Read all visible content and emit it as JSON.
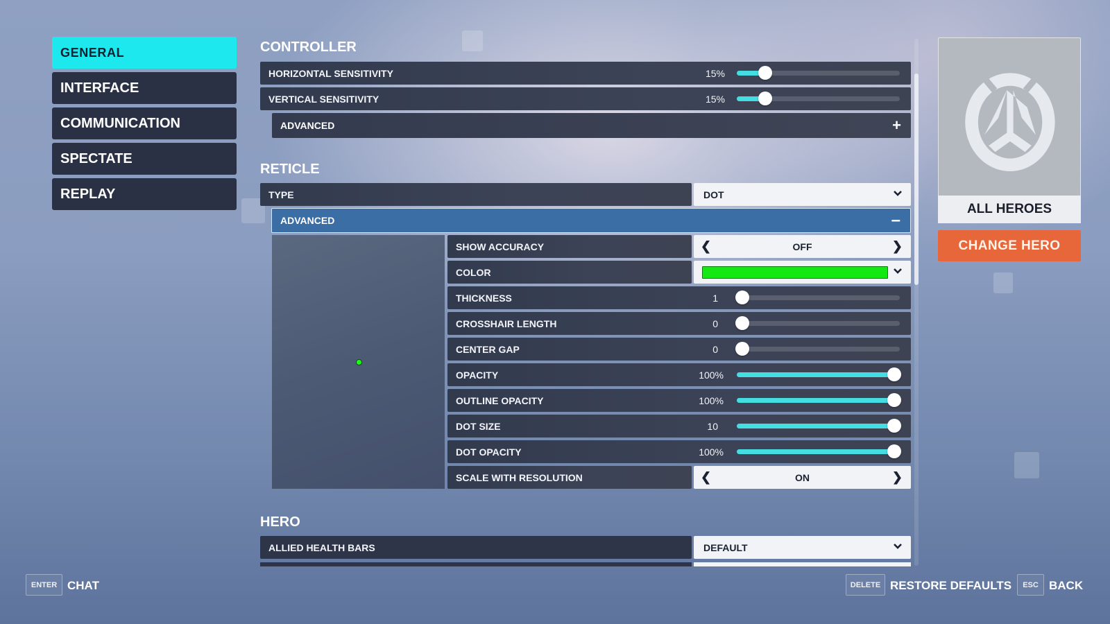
{
  "sidebar": {
    "items": [
      {
        "label": "GENERAL",
        "active": true
      },
      {
        "label": "INTERFACE",
        "active": false
      },
      {
        "label": "COMMUNICATION",
        "active": false
      },
      {
        "label": "SPECTATE",
        "active": false
      },
      {
        "label": "REPLAY",
        "active": false
      }
    ]
  },
  "controller": {
    "title": "CONTROLLER",
    "horizontal_sensitivity": {
      "label": "HORIZONTAL SENSITIVITY",
      "value": "15%",
      "fraction": 0.15
    },
    "vertical_sensitivity": {
      "label": "VERTICAL SENSITIVITY",
      "value": "15%",
      "fraction": 0.15
    },
    "advanced": {
      "label": "ADVANCED",
      "icon": "plus-icon",
      "expanded": false
    }
  },
  "reticle": {
    "title": "RETICLE",
    "type": {
      "label": "TYPE",
      "value": "DOT"
    },
    "advanced": {
      "label": "ADVANCED",
      "icon": "minus-icon",
      "expanded": true
    },
    "preview": {
      "dot_color": "#1aff1a"
    },
    "show_accuracy": {
      "label": "SHOW ACCURACY",
      "value": "OFF"
    },
    "color": {
      "label": "COLOR",
      "value": "#13e813"
    },
    "thickness": {
      "label": "THICKNESS",
      "value": "1",
      "fraction": 0.0
    },
    "crosshair_length": {
      "label": "CROSSHAIR LENGTH",
      "value": "0",
      "fraction": 0.0
    },
    "center_gap": {
      "label": "CENTER GAP",
      "value": "0",
      "fraction": 0.0
    },
    "opacity": {
      "label": "OPACITY",
      "value": "100%",
      "fraction": 1.0
    },
    "outline_opacity": {
      "label": "OUTLINE OPACITY",
      "value": "100%",
      "fraction": 1.0
    },
    "dot_size": {
      "label": "DOT SIZE",
      "value": "10",
      "fraction": 1.0
    },
    "dot_opacity": {
      "label": "DOT OPACITY",
      "value": "100%",
      "fraction": 1.0
    },
    "scale_with_resolution": {
      "label": "SCALE WITH RESOLUTION",
      "value": "ON"
    }
  },
  "hero": {
    "title": "HERO",
    "allied_health_bars": {
      "label": "ALLIED HEALTH BARS",
      "value": "DEFAULT"
    }
  },
  "hero_panel": {
    "name": "ALL HEROES",
    "change_button": "CHANGE HERO",
    "logo_icon": "overwatch-logo-icon"
  },
  "footer": {
    "chat": {
      "key": "ENTER",
      "label": "CHAT"
    },
    "restore": {
      "key": "DELETE",
      "label": "RESTORE DEFAULTS"
    },
    "back": {
      "key": "ESC",
      "label": "BACK"
    }
  },
  "colors": {
    "accent": "#1ce8ee",
    "slider_fill": "#44dde2",
    "advanced_open": "#3a6ea5",
    "change_hero": "#e7663a"
  }
}
